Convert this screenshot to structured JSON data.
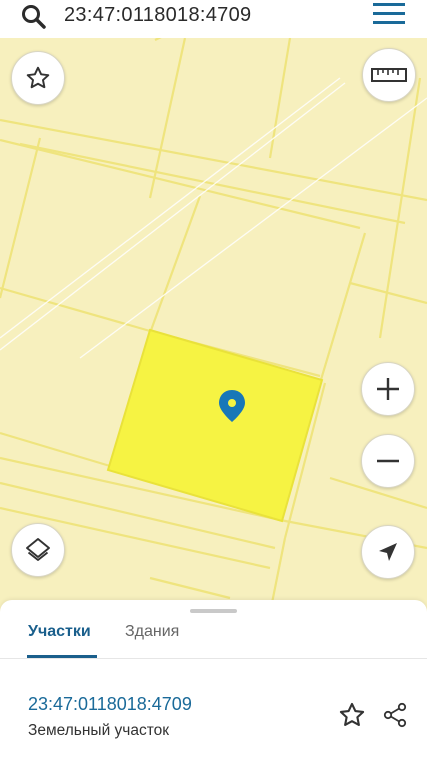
{
  "search": {
    "query": "23:47:0118018:4709",
    "icon": "search-icon",
    "menu_icon": "hamburger-menu-icon"
  },
  "map": {
    "background_color": "#F7F0BE",
    "boundary_color": "#EFE47E",
    "selected_parcel_color": "#F6F343",
    "marker_color": "#1877B8",
    "controls": {
      "favorite_icon": "star-outline-icon",
      "ruler_icon": "ruler-icon",
      "zoom_in_icon": "plus-icon",
      "zoom_out_icon": "minus-icon",
      "layers_icon": "layers-icon",
      "locate_icon": "navigation-arrow-icon"
    }
  },
  "sheet": {
    "tabs": [
      {
        "label": "Участки",
        "active": true
      },
      {
        "label": "Здания",
        "active": false
      }
    ],
    "active_color": "#1A5F8C",
    "parcel": {
      "id": "23:47:0118018:4709",
      "type": "Земельный участок"
    },
    "actions": {
      "favorite_icon": "star-outline-icon",
      "share_icon": "share-icon"
    }
  }
}
